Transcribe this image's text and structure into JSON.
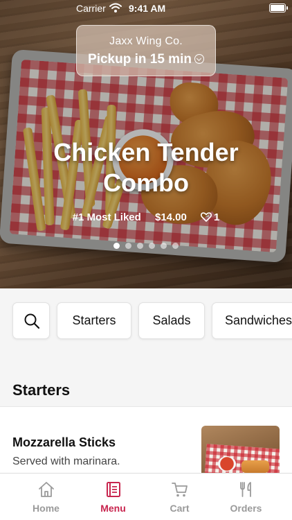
{
  "status_bar": {
    "carrier": "Carrier",
    "time": "9:41 AM"
  },
  "location": {
    "store_name": "Jaxx Wing Co.",
    "pickup": "Pickup in 15 min"
  },
  "hero": {
    "title_line1": "Chicken Tender",
    "title_line2": "Combo",
    "badge": "#1 Most Liked",
    "price": "$14.00",
    "likes": "1",
    "carousel": {
      "count": 6,
      "active_index": 0
    }
  },
  "categories": {
    "search_icon": "search-icon",
    "items": [
      "Starters",
      "Salads",
      "Sandwiches"
    ]
  },
  "menu": {
    "section_title": "Starters",
    "items": [
      {
        "name": "Mozzarella Sticks",
        "description": "Served with marinara."
      }
    ]
  },
  "tabbar": {
    "tabs": [
      {
        "label": "Home",
        "icon": "home-icon"
      },
      {
        "label": "Menu",
        "icon": "menu-icon"
      },
      {
        "label": "Cart",
        "icon": "cart-icon"
      },
      {
        "label": "Orders",
        "icon": "fork-knife-icon"
      }
    ],
    "active": "Menu"
  },
  "colors": {
    "accent": "#c8254e",
    "inactive": "#9a9a9a",
    "background": "#f5f5f5"
  }
}
